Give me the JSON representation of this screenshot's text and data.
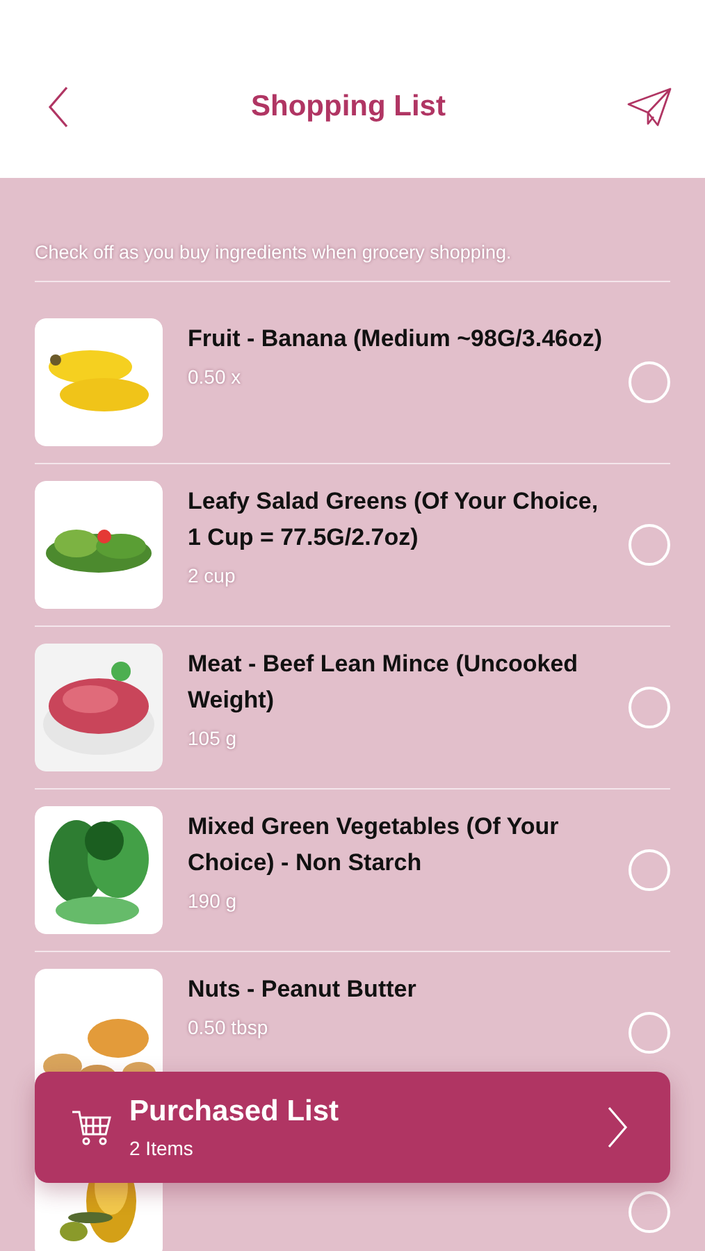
{
  "header": {
    "title": "Shopping List"
  },
  "instructions": "Check off as you buy ingredients when grocery shopping.",
  "items": [
    {
      "name": "Fruit - Banana (Medium ~98G/3.46oz)",
      "quantity": "0.50 x",
      "checked": false
    },
    {
      "name": "Leafy Salad Greens (Of Your Choice, 1 Cup = 77.5G/2.7oz)",
      "quantity": "2 cup",
      "checked": false
    },
    {
      "name": "Meat - Beef Lean Mince (Uncooked Weight)",
      "quantity": "105 g",
      "checked": false
    },
    {
      "name": "Mixed Green Vegetables (Of Your Choice) - Non Starch",
      "quantity": "190 g",
      "checked": false
    },
    {
      "name": "Nuts - Peanut Butter",
      "quantity": "0.50 tbsp",
      "checked": false
    },
    {
      "checked": false
    }
  ],
  "purchased": {
    "title": "Purchased List",
    "count": "2 Items"
  }
}
